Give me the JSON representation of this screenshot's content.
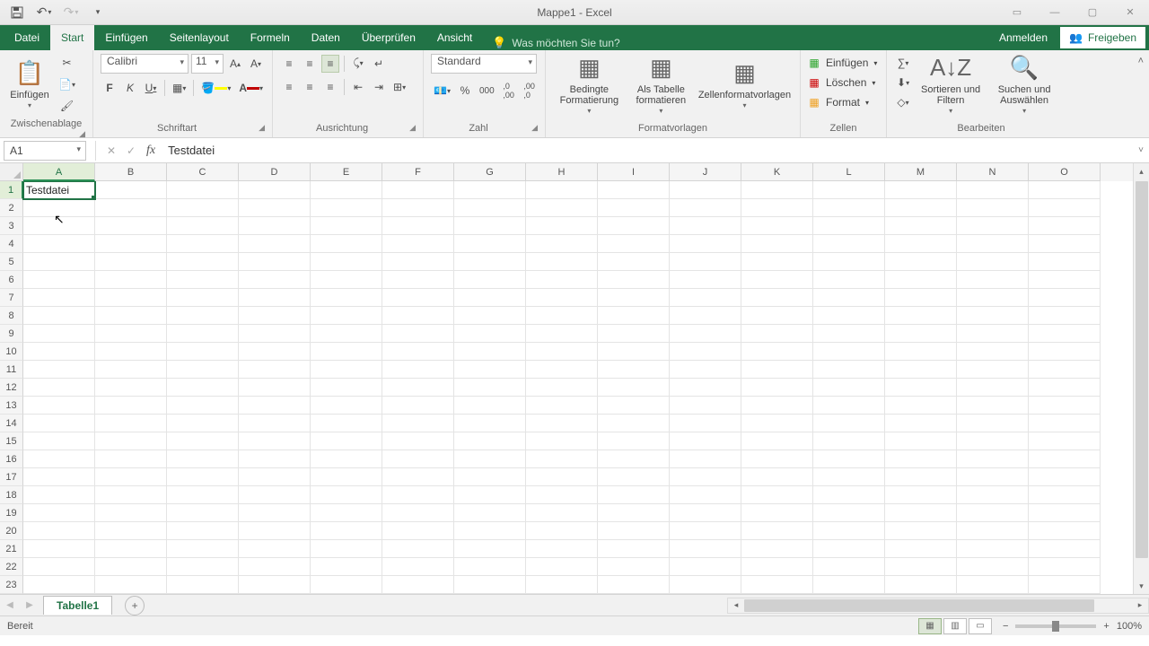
{
  "title": "Mappe1 - Excel",
  "tabs": {
    "file": "Datei",
    "start": "Start",
    "einfuegen": "Einfügen",
    "seitenlayout": "Seitenlayout",
    "formeln": "Formeln",
    "daten": "Daten",
    "ueberpruefen": "Überprüfen",
    "ansicht": "Ansicht",
    "tellme": "Was möchten Sie tun?",
    "anmelden": "Anmelden",
    "freigeben": "Freigeben"
  },
  "ribbon": {
    "clipboard": {
      "label": "Zwischenablage",
      "paste": "Einfügen"
    },
    "font": {
      "label": "Schriftart",
      "name": "Calibri",
      "size": "11",
      "bold": "F",
      "italic": "K",
      "underline": "U"
    },
    "align": {
      "label": "Ausrichtung"
    },
    "number": {
      "label": "Zahl",
      "format": "Standard"
    },
    "styles": {
      "label": "Formatvorlagen",
      "conditional": "Bedingte Formatierung",
      "astable": "Als Tabelle formatieren",
      "cellstyles": "Zellenformatvorlagen"
    },
    "cells": {
      "label": "Zellen",
      "insert": "Einfügen",
      "delete": "Löschen",
      "format": "Format"
    },
    "editing": {
      "label": "Bearbeiten",
      "sort": "Sortieren und Filtern",
      "find": "Suchen und Auswählen"
    }
  },
  "formula": {
    "cellref": "A1",
    "value": "Testdatei"
  },
  "columns": [
    "A",
    "B",
    "C",
    "D",
    "E",
    "F",
    "G",
    "H",
    "I",
    "J",
    "K",
    "L",
    "M",
    "N",
    "O"
  ],
  "rows": [
    "1",
    "2",
    "3",
    "4",
    "5",
    "6",
    "7",
    "8",
    "9",
    "10",
    "11",
    "12",
    "13",
    "14",
    "15",
    "16",
    "17",
    "18",
    "19",
    "20",
    "21",
    "22",
    "23"
  ],
  "cells": {
    "A1": "Testdatei"
  },
  "sheet": {
    "tab": "Tabelle1"
  },
  "status": {
    "ready": "Bereit",
    "zoom": "100%"
  }
}
